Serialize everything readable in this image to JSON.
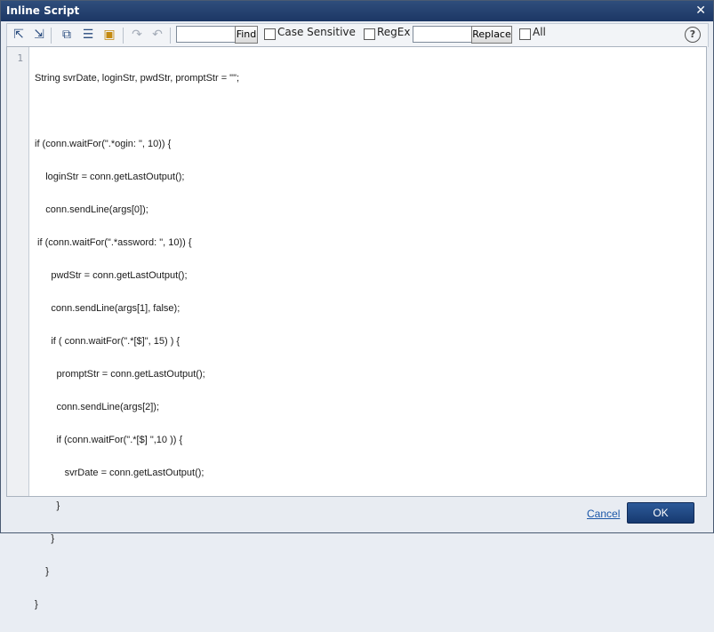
{
  "window": {
    "title": "Inline Script",
    "close_glyph": "✕"
  },
  "toolbar": {
    "icons": [
      "import-icon",
      "export-icon",
      "copy-icon",
      "indent-icon",
      "paste-icon",
      "redo-icon",
      "undo-icon"
    ],
    "find_value": "",
    "find_label": "Find",
    "case_sensitive_label": "Case Sensitive",
    "case_sensitive_checked": false,
    "regex_label": "RegEx",
    "regex_checked": false,
    "replace_value": "",
    "replace_label": "Replace",
    "all_label": "All",
    "all_checked": false,
    "help_label": "?"
  },
  "editor": {
    "line_number": "1",
    "lines": [
      "String svrDate, loginStr, pwdStr, promptStr = \"\";",
      "",
      "if (conn.waitFor(\".*ogin: \", 10)) {",
      "    loginStr = conn.getLastOutput();",
      "    conn.sendLine(args[0]);",
      " if (conn.waitFor(\".*assword: \", 10)) {",
      "      pwdStr = conn.getLastOutput();",
      "      conn.sendLine(args[1], false);",
      "      if ( conn.waitFor(\".*[$]\", 15) ) {",
      "        promptStr = conn.getLastOutput();",
      "        conn.sendLine(args[2]);",
      "        if (conn.waitFor(\".*[$] \",10 )) {",
      "           svrDate = conn.getLastOutput();",
      "        }",
      "      }",
      "    }",
      "}"
    ]
  },
  "footer": {
    "cancel_label": "Cancel",
    "ok_label": "OK"
  }
}
